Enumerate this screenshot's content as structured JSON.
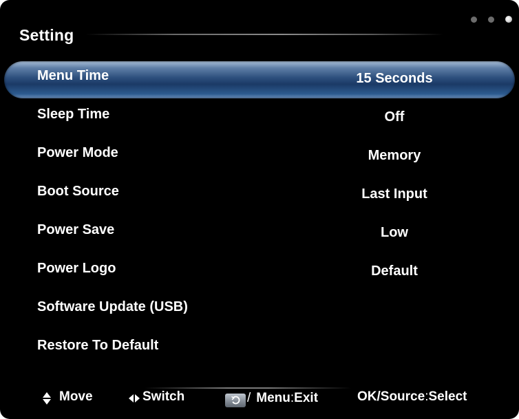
{
  "header": {
    "title": "Setting"
  },
  "menu": {
    "items": [
      {
        "label": "Menu Time",
        "value": "15 Seconds",
        "selected": true
      },
      {
        "label": "Sleep Time",
        "value": "Off"
      },
      {
        "label": "Power Mode",
        "value": "Memory"
      },
      {
        "label": "Boot Source",
        "value": "Last Input"
      },
      {
        "label": "Power Save",
        "value": "Low"
      },
      {
        "label": "Power Logo",
        "value": "Default"
      },
      {
        "label": "Software Update (USB)",
        "value": ""
      },
      {
        "label": "Restore To Default",
        "value": ""
      }
    ]
  },
  "footer": {
    "move_label": "Move",
    "switch_label": "Switch",
    "exit_slash": "/",
    "exit_key": "Menu",
    "exit_sep": ":",
    "exit_label": "Exit",
    "select_key": "OK/Source",
    "select_sep": ":",
    "select_label": "Select"
  },
  "colors": {
    "background": "#000000",
    "text": "#ffffff",
    "highlight": "#2c4e7c",
    "highlight_edge": "#a9bfd9"
  },
  "icons": {
    "move": "up-down-arrows-icon",
    "switch": "left-right-arrows-icon",
    "back": "return-icon",
    "window_dots": "dots-icon"
  }
}
